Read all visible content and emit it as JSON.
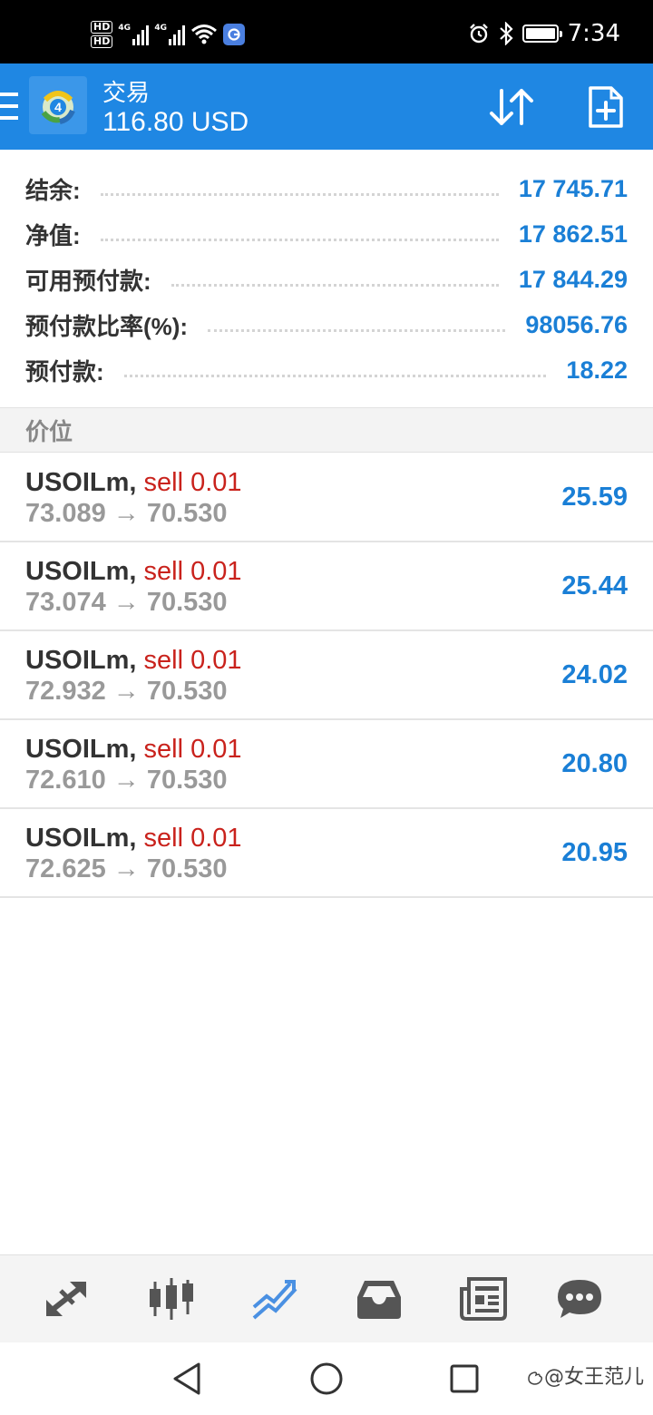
{
  "status_bar": {
    "sim1": "HD",
    "sim2": "HD",
    "net1": "4G",
    "net2": "4G",
    "time": "7:34"
  },
  "header": {
    "title": "交易",
    "subtitle": "116.80 USD",
    "accent_color": "#1f87e3"
  },
  "summary": [
    {
      "label": "结余:",
      "value": "17 745.71"
    },
    {
      "label": "净值:",
      "value": "17 862.51"
    },
    {
      "label": "可用预付款:",
      "value": "17 844.29"
    },
    {
      "label": "预付款比率(%):",
      "value": "98056.76"
    },
    {
      "label": "预付款:",
      "value": "18.22"
    }
  ],
  "section_title": "价位",
  "positions": [
    {
      "symbol": "USOILm,",
      "side": "sell 0.01",
      "prices": "73.089 → 70.530",
      "profit": "25.59"
    },
    {
      "symbol": "USOILm,",
      "side": "sell 0.01",
      "prices": "73.074 → 70.530",
      "profit": "25.44"
    },
    {
      "symbol": "USOILm,",
      "side": "sell 0.01",
      "prices": "72.932 → 70.530",
      "profit": "24.02"
    },
    {
      "symbol": "USOILm,",
      "side": "sell 0.01",
      "prices": "72.610 → 70.530",
      "profit": "20.80"
    },
    {
      "symbol": "USOILm,",
      "side": "sell 0.01",
      "prices": "72.625 → 70.530",
      "profit": "20.95"
    }
  ],
  "bottom_nav": [
    {
      "icon": "quotes-arrows-icon",
      "active": false
    },
    {
      "icon": "candlestick-chart-icon",
      "active": false
    },
    {
      "icon": "trade-trend-icon",
      "active": true
    },
    {
      "icon": "history-inbox-icon",
      "active": false
    },
    {
      "icon": "news-icon",
      "active": false
    },
    {
      "icon": "chat-icon",
      "active": false
    }
  ],
  "watermark": "@女王范儿"
}
